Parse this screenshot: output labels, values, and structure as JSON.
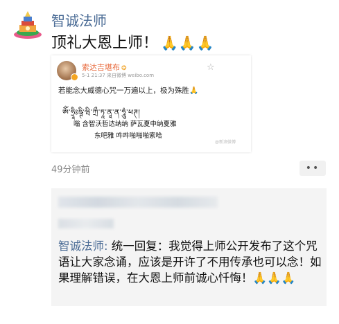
{
  "post": {
    "username": "智诚法师",
    "text": "顶礼大恩上师！",
    "hands": "🙏🙏🙏",
    "timestamp": "49分钟前",
    "more": "••"
  },
  "embed": {
    "author": "索达吉堪布",
    "vip": "❂",
    "meta": "5-1 21:37  来自微博 weibo.com",
    "body": "若能念大威德心咒一万遍以上，极为殊胜🙏",
    "tibetan": "ཨོཾ་ཧྲཱིཿཥྚི་ཝི་ཀྲྀ་ཏཱ་ནཱ་ན་ཧཱུཾ་ཕཊ།",
    "line1": "嗡  含智沃哲达纳纳  萨瓦夏中纳夏雅",
    "line2": "东吧雅  吽吽啪啪啪索哈",
    "watermark": "@新浪微博"
  },
  "comment": {
    "reply_name": "智诚法师:",
    "reply_text": " 统一回复：我觉得上师公开发布了这个咒语让大家念诵，应该是开许了不用传承也可以念！如果理解错误，在大恩上师前诚心忏悔！",
    "reply_hands": "🙏🙏🙏"
  }
}
